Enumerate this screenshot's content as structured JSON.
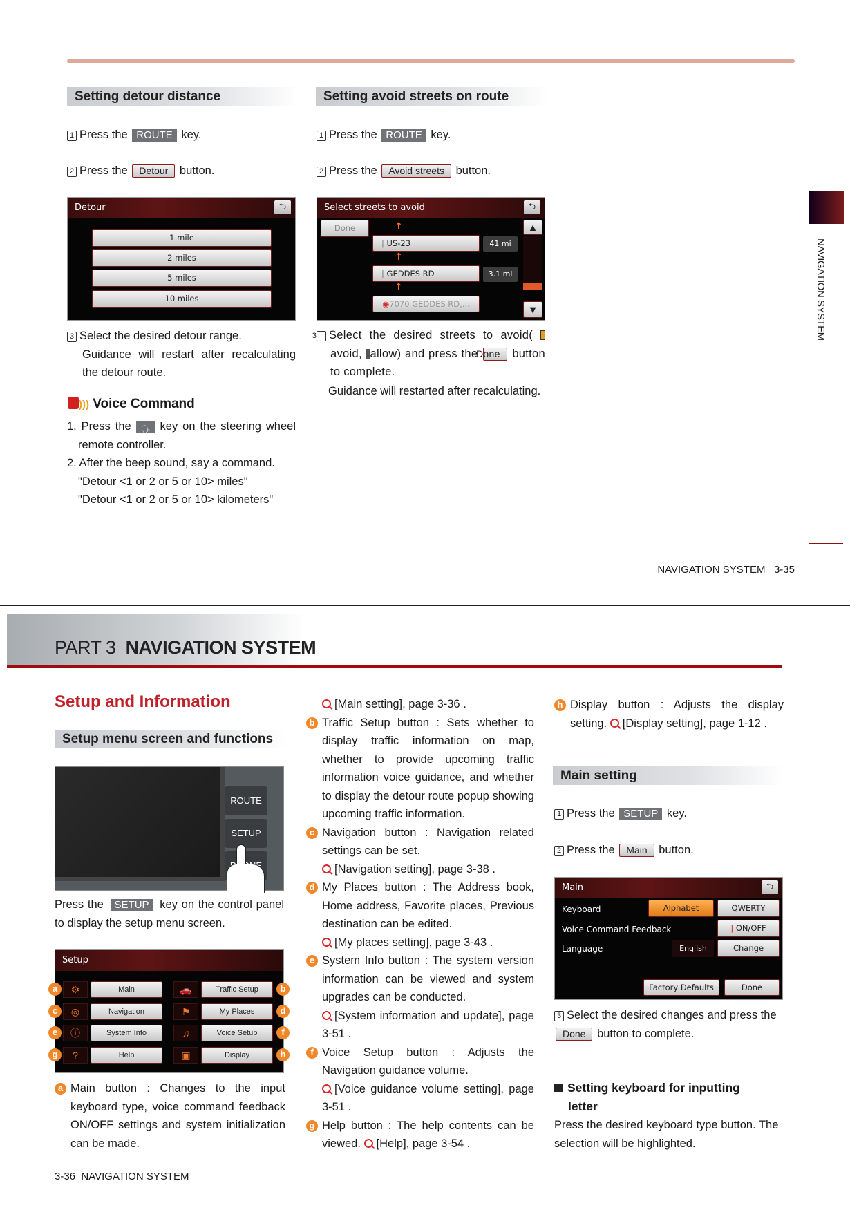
{
  "top": {
    "left": {
      "header": "Setting detour distance",
      "step1": {
        "num": "1",
        "pre": "Press the",
        "key": "ROUTE",
        "post": "key."
      },
      "step2": {
        "num": "2",
        "pre": "Press the",
        "button": "Detour",
        "post": "button."
      },
      "screen": {
        "title": "Detour",
        "options": [
          "1 mile",
          "2 miles",
          "5 miles",
          "10 miles"
        ]
      },
      "step3": {
        "num": "3",
        "text": "Select the desired detour range.",
        "note": "Guidance will restart after recalculating the detour route."
      },
      "voice": {
        "title": "Voice Command",
        "line1_pre": "1. Press the",
        "line1_post": "key on the steering wheel remote controller.",
        "line2": "2. After the beep sound, say a command.",
        "cmd1": "\"Detour <1 or 2 or 5 or 10> miles\"",
        "cmd2": "\"Detour <1 or 2 or 5 or 10> kilometers\""
      }
    },
    "right": {
      "header": "Setting avoid streets on route",
      "step1": {
        "num": "1",
        "pre": "Press the",
        "key": "ROUTE",
        "post": "key."
      },
      "step2": {
        "num": "2",
        "pre": "Press the",
        "button": "Avoid streets",
        "post": "button."
      },
      "screen": {
        "title": "Select streets to avoid",
        "done": "Done",
        "streets": [
          {
            "name": "US-23",
            "distance": "41 mi"
          },
          {
            "name": "GEDDES RD",
            "distance": "3.1 mi"
          }
        ],
        "destination": "7070 GEDDES RD,..."
      },
      "step3": {
        "num": "3",
        "t1": "Select the desired streets to avoid(",
        "t2": "avoid,",
        "t3": "allow) and press the",
        "button": "Done",
        "t4": "button to complete."
      },
      "note": "Guidance will  restarted after recalculating."
    },
    "side_tab": "NAVIGATION SYSTEM",
    "footer": {
      "label": "NAVIGATION SYSTEM",
      "page": "3-35"
    }
  },
  "bottom": {
    "part": {
      "label": "PART 3",
      "title": "NAVIGATION SYSTEM"
    },
    "section_title": "Setup and Information",
    "left": {
      "header": "Setup menu screen and functions",
      "panel_keys": [
        "ROUTE",
        "SETUP",
        "PHONE"
      ],
      "caption": {
        "pre": "Press the",
        "key": "SETUP",
        "post": "key on the control panel to display the setup menu screen."
      },
      "setup_screen": {
        "title": "Setup",
        "items": [
          {
            "letter": "a",
            "label": "Main"
          },
          {
            "letter": "b",
            "label": "Traffic Setup"
          },
          {
            "letter": "c",
            "label": "Navigation"
          },
          {
            "letter": "d",
            "label": "My Places"
          },
          {
            "letter": "e",
            "label": "System Info"
          },
          {
            "letter": "f",
            "label": "Voice Setup"
          },
          {
            "letter": "g",
            "label": "Help"
          },
          {
            "letter": "h",
            "label": "Display"
          }
        ]
      },
      "item_a": {
        "letter": "a",
        "text": "Main button : Changes to the input keyboard type, voice command feedback ON/OFF settings and system initialization can be made."
      }
    },
    "middle": {
      "a_ref": "[Main setting], page 3-36 .",
      "items": [
        {
          "letter": "b",
          "text": "Traffic Setup button : Sets whether to display traffic information on map, whether to provide upcoming traffic information voice guidance, and whether to display the detour route popup showing upcoming traffic information.",
          "ref": ""
        },
        {
          "letter": "c",
          "text": "Navigation button : Navigation related settings can be set.",
          "ref": "[Navigation setting], page 3-38 ."
        },
        {
          "letter": "d",
          "text": "My Places button : The Address book, Home address, Favorite places, Previous destination can be edited.",
          "ref": "[My places setting], page 3-43 ."
        },
        {
          "letter": "e",
          "text": "System Info button : The system version information can be viewed and system upgrades can be conducted.",
          "ref": "[System information and update], page 3-51 ."
        },
        {
          "letter": "f",
          "text": "Voice Setup button : Adjusts the Navigation guidance volume.",
          "ref": "[Voice guidance volume setting], page 3-51 ."
        }
      ],
      "item_g": {
        "letter": "g",
        "text": "Help button : The help contents can be viewed.",
        "ref": "[Help], page 3-54 ."
      }
    },
    "right": {
      "item_h": {
        "letter": "h",
        "text": "Display button : Adjusts the display setting.",
        "ref": "[Display setting], page 1-12 ."
      },
      "header": "Main setting",
      "step1": {
        "num": "1",
        "pre": "Press the",
        "key": "SETUP",
        "post": "key."
      },
      "step2": {
        "num": "2",
        "pre": "Press the",
        "button": "Main",
        "post": "button."
      },
      "screen": {
        "title": "Main",
        "keyboard_label": "Keyboard",
        "keyboard_options": [
          "Alphabet",
          "QWERTY"
        ],
        "keyboard_selected": "Alphabet",
        "voice_label": "Voice Command Feedback",
        "voice_button": "ON/OFF",
        "language_label": "Language",
        "language_value": "English",
        "language_button": "Change",
        "factory": "Factory Defaults",
        "done": "Done"
      },
      "step3": {
        "num": "3",
        "pre": "Select the desired changes and press the",
        "button": "Done",
        "post": "button to complete."
      },
      "keyboard_heading": "Setting keyboard for inputting letter",
      "keyboard_text": "Press the desired keyboard type button. The selection will be highlighted."
    },
    "footer": {
      "page": "3-36",
      "label": "NAVIGATION SYSTEM"
    }
  },
  "colors": {
    "accent_red": "#c0202a",
    "marker_orange": "#f0882a",
    "top_rule": "#e0a898",
    "part_bar": "#9e0c12"
  }
}
